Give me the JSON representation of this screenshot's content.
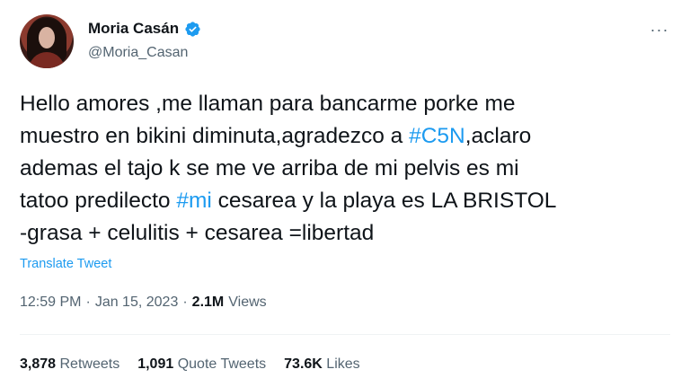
{
  "author": {
    "display_name": "Moria Casán",
    "handle": "@Moria_Casan",
    "verified": true
  },
  "more_glyph": "···",
  "tweet": {
    "lines": [
      [
        {
          "t": "Hello amores ,me llaman para bancarme porke me"
        }
      ],
      [
        {
          "t": "muestro en bikini diminuta,agradezco a "
        },
        {
          "t": "#C5N",
          "hashtag": true
        },
        {
          "t": ",aclaro"
        }
      ],
      [
        {
          "t": "ademas el tajo k se me ve arriba de mi pelvis es mi"
        }
      ],
      [
        {
          "t": "tatoo predilecto "
        },
        {
          "t": "#mi",
          "hashtag": true
        },
        {
          "t": " cesarea y la playa es LA BRISTOL"
        }
      ],
      [
        {
          "t": "-grasa + celulitis + cesarea =libertad"
        }
      ]
    ],
    "translate_label": "Translate Tweet"
  },
  "meta": {
    "time": "12:59 PM",
    "separator": "·",
    "date": "Jan 15, 2023",
    "views_count": "2.1M",
    "views_label": "Views"
  },
  "stats": {
    "retweets": {
      "count": "3,878",
      "label": "Retweets"
    },
    "quotes": {
      "count": "1,091",
      "label": "Quote Tweets"
    },
    "likes": {
      "count": "73.6K",
      "label": "Likes"
    }
  },
  "colors": {
    "link": "#1d9bf0",
    "secondary_text": "#536471",
    "primary_text": "#0f1419"
  }
}
